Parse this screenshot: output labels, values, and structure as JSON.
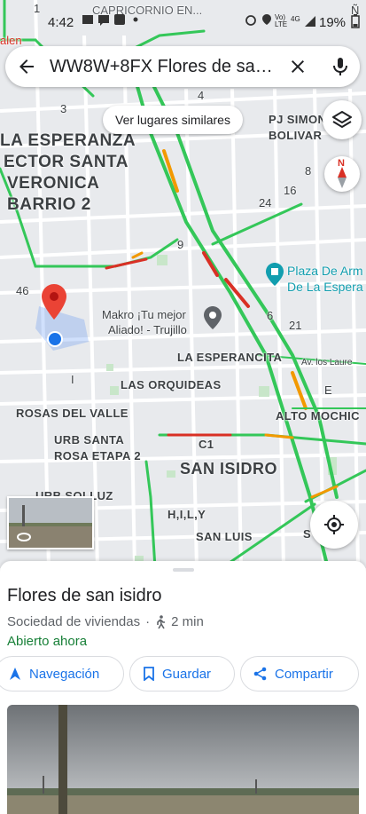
{
  "status_bar": {
    "time": "4:42",
    "network_a": "Vo)",
    "network_b": "LTE",
    "network_c": "4G",
    "battery": "19%"
  },
  "search": {
    "query": "WW8W+8FX Flores de san isidro"
  },
  "map": {
    "similar_places_label": "Ver lugares similares",
    "compass_label": "N",
    "labels": {
      "top_street": "CAPRICORNIO EN...",
      "top_left": "alen",
      "top_right": "Ñ",
      "la_esperanza": "LA ESPERANZA",
      "sector_santa": "ECTOR SANTA",
      "veronica": "VERONICA",
      "barrio_2": "BARRIO 2",
      "pj_simon": "PJ SIMON",
      "bolivar": "BOLIVAR",
      "plaza_line1": "Plaza De Arm",
      "plaza_line2": "De La Espera",
      "makro_line1": "Makro ¡Tu mejor",
      "makro_line2": "Aliado! - Trujillo",
      "la_esperancita": "LA ESPERANCITA",
      "las_orquideas": "LAS ORQUIDEAS",
      "rosas_del_valle": "ROSAS DEL VALLE",
      "alto_mochica": "ALTO MOCHIC",
      "urb_santa_1": "URB SANTA",
      "urb_santa_2": "ROSA ETAPA 2",
      "san_isidro": "SAN ISIDRO",
      "urb_solluz": "URB SOLLUZ",
      "hily": "H,I,L,Y",
      "san_luis": "SAN LUIS",
      "av_los_laureles": "Av. los Laure",
      "route_c1": "C1",
      "n_1": "1",
      "n_3": "3",
      "n_4": "4",
      "n_8": "8",
      "n_16": "16",
      "n_24": "24",
      "n_9": "9",
      "n_46": "46",
      "n_6": "6",
      "n_21": "21",
      "n_e": "E",
      "n_i": "I",
      "n_s": "S"
    }
  },
  "place": {
    "title": "Flores de san isidro",
    "category": "Sociedad de viviendas",
    "separator": "·",
    "walk_time": "2 min",
    "open_status": "Abierto ahora"
  },
  "actions": {
    "navigation": "Navegación",
    "save": "Guardar",
    "share": "Compartir"
  },
  "colors": {
    "accent": "#1a73e8",
    "open": "#188038",
    "traffic_green": "#34c759",
    "traffic_orange": "#f29900",
    "traffic_red": "#d93025",
    "pin": "#ea4335"
  }
}
